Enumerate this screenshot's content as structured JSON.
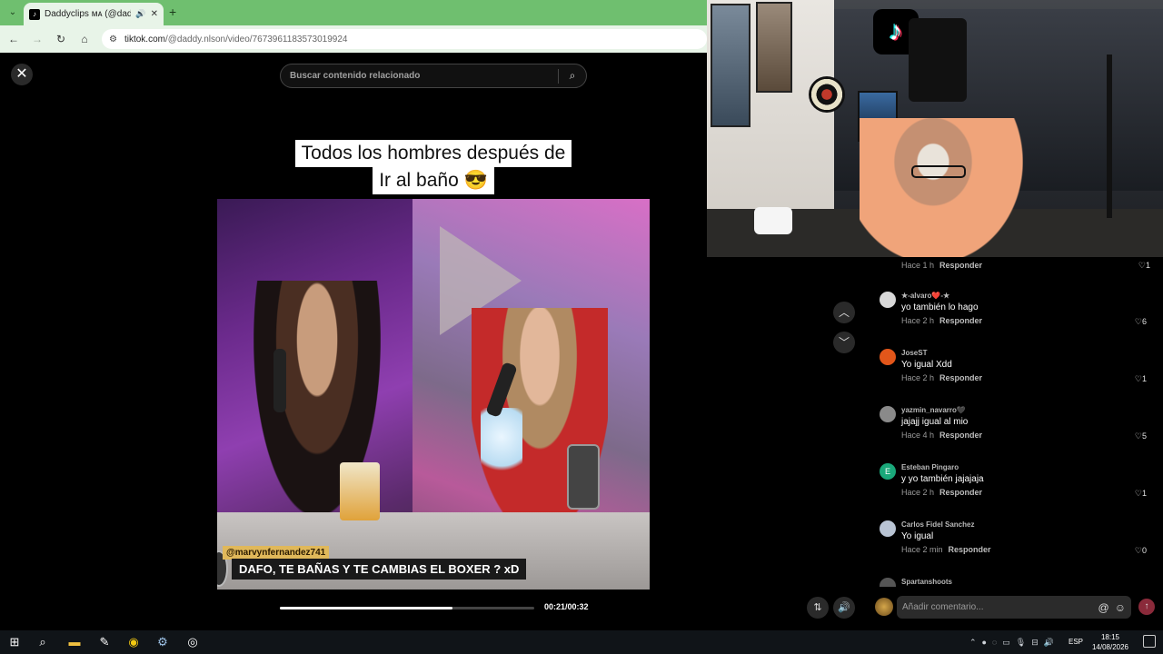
{
  "browser": {
    "tab_title": "Daddyclips ᴍᴀ (@daddy.nlso",
    "url_domain": "tiktok.com",
    "url_path": "/@daddy.nlson/video/7673961183573019924",
    "new_tab_icon": "plus-icon"
  },
  "player": {
    "search_placeholder": "Buscar contenido relacionado",
    "caption_line1": "Todos los hombres después de",
    "caption_line2": "Ir al baño 😎",
    "handle": "@marvynfernandez741",
    "subtitle": "DAFO, TE BAÑAS Y TE CAMBIAS EL BOXER ? xD",
    "time": "00:21/00:32",
    "progress_fraction": 0.68
  },
  "comments": {
    "first": {
      "meta": "Hace 1 h",
      "reply": "Responder",
      "likes": "1"
    },
    "items": [
      {
        "user": "★-alvaro❤️-★",
        "text": "yo también lo hago",
        "meta": "Hace 2 h",
        "reply": "Responder",
        "likes": "6",
        "avatar_color": "#d8d8d8",
        "initial": ""
      },
      {
        "user": "JoseST",
        "text": "Yo igual Xdd",
        "meta": "Hace 2 h",
        "reply": "Responder",
        "likes": "1",
        "avatar_color": "#e2561a",
        "initial": ""
      },
      {
        "user": "yazmin_navarro🖤",
        "text": "jajajj igual al mio",
        "meta": "Hace 4 h",
        "reply": "Responder",
        "likes": "5",
        "avatar_color": "#8a8a8a",
        "initial": ""
      },
      {
        "user": "Esteban Pingaro",
        "text": "y yo también jajajaja",
        "meta": "Hace 2 h",
        "reply": "Responder",
        "likes": "1",
        "avatar_color": "#1aa87a",
        "initial": "E"
      },
      {
        "user": "Carlos Fidel Sanchez",
        "text": "Yo igual",
        "meta": "Hace 2 min",
        "reply": "Responder",
        "likes": "0",
        "avatar_color": "#b9c4d4",
        "initial": ""
      },
      {
        "user": "Spartanshoots",
        "text": "",
        "meta": "",
        "reply": "",
        "likes": "",
        "avatar_color": "#555",
        "initial": ""
      }
    ],
    "input_placeholder": "Añadir comentario..."
  },
  "taskbar": {
    "lang": "ESP",
    "time": "18:15",
    "date": "14/08/2026"
  },
  "colors": {
    "browser_frame": "#6fbf6f",
    "tiktok_bg": "#000000",
    "send_button": "#8a2a3a"
  }
}
